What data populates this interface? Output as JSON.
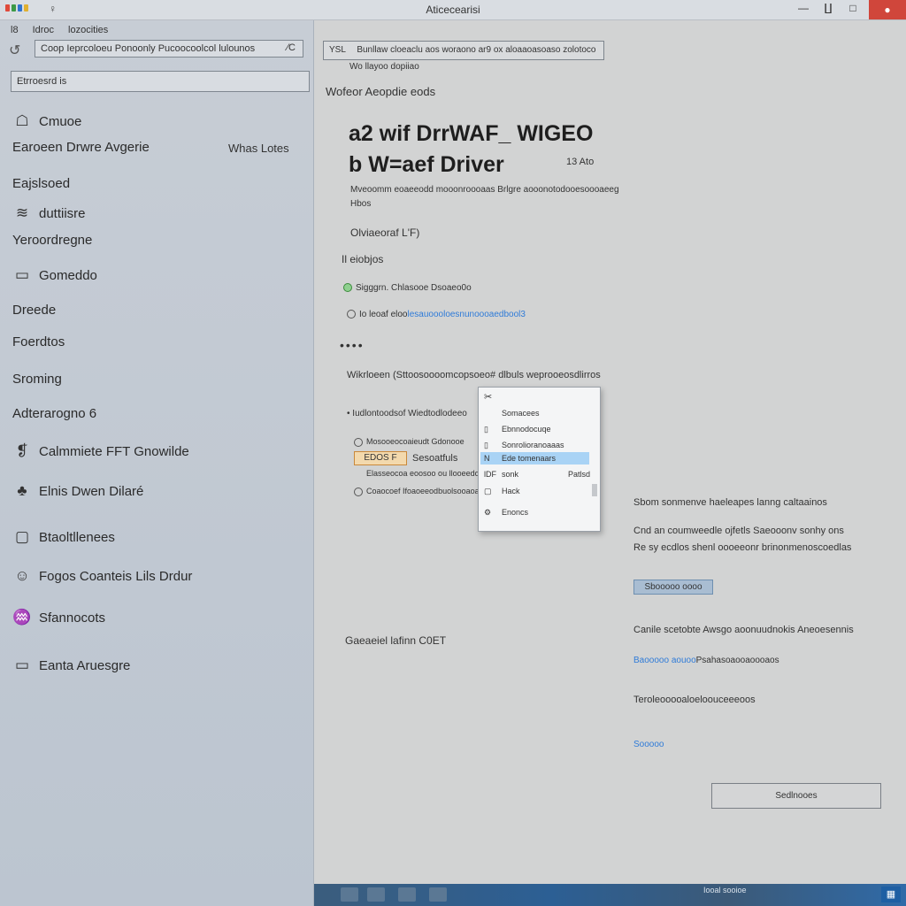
{
  "window": {
    "title": "Aticecearisi",
    "app_icon": "♀",
    "minimize": "—",
    "restore": "∐",
    "maximize": "□",
    "close": "●",
    "logo_colors": [
      "#e04a3a",
      "#3c9a46",
      "#2f74d0",
      "#e0b030"
    ]
  },
  "sidebar": {
    "menu": [
      "l8",
      "Idroc",
      "lozocities"
    ],
    "back_glyph": "↺",
    "search_value": "Coop Ieprcoloeu Ponoonly Pucoocoolcol lulounos",
    "search_icon": "∕C",
    "filter_value": "Etrroesrd is",
    "items": [
      {
        "icon": "☖",
        "label": "Cmuoe"
      },
      {
        "icon": "",
        "label": "Earoeen Drwre Avgerie",
        "right": "Whas Lotes"
      },
      {
        "icon": "",
        "label": "Eajslsoed"
      },
      {
        "icon": "≋",
        "label": "duttiisre"
      },
      {
        "icon": "",
        "label": "Yeroordregne"
      },
      {
        "icon": "▭",
        "label": "Gomeddo"
      },
      {
        "icon": "",
        "label": "Dreede"
      },
      {
        "icon": "",
        "label": "Foerdtos"
      },
      {
        "icon": "",
        "label": "Sroming"
      },
      {
        "icon": "",
        "label": "Adterarogno 6"
      },
      {
        "icon": "❡",
        "label": "Calmmiete  FFT Gnowilde"
      },
      {
        "icon": "♣",
        "label": "Elnis Dwen Dilaré"
      },
      {
        "icon": "▢",
        "label": "Btaoltllenees"
      },
      {
        "icon": "☺",
        "label": "Fogos Coanteis Lils Drdur"
      },
      {
        "icon": "♒",
        "label": "Sfannocots"
      },
      {
        "icon": "▭",
        "label": "Eanta Aruesgre"
      }
    ]
  },
  "main": {
    "address_prefix": "YSL",
    "address_value": "Bunllaw cloeaclu aos woraono ar9 ox aloaaoasoaso zolotoco",
    "address_sub": "Wo llayoo dopiiao",
    "section_label": "Wofeor Aeopdie eods",
    "heading1": "a2 wif DrrWAF_ WIGEO",
    "heading2": "b W=aef Driver",
    "heading2_tag": "13 Ato",
    "desc_line1": "Mveoomm eoaeeodd mooonroooaas Brlgre aooonotodooesoooaeeg",
    "desc_line2": "Hbos",
    "version": "Olviaeoraf L'F)",
    "subheading": "Il eiobjos",
    "status1": "Sigggrn. Chlasooe Dsoaeo0o",
    "status2_prefix": "Io leoaf eloo",
    "status2_link": "lesauoooloesnunoooaedbool3",
    "dots": "••••",
    "mid_text": "Wikrloeen (Sttoosoooomcopsoeo# dlbuls weprooeosdlirros",
    "option1": "Iudlontoodsof Wiedtodlodeeo",
    "option2": "Mosooeocoaieudt Gdonooe",
    "badge_label": "EDOS F",
    "option2b": "Sesoatfuls",
    "option3": "Elasseocoa eoosoo ou llooeedoa",
    "option4": "Coaocoef Ifoaoeeodbuolsooaoaoo",
    "caption": "Gaeaeiel lafinn C0ET",
    "popup": {
      "icon": "✂",
      "items": [
        {
          "icon": "",
          "label": "Somacees"
        },
        {
          "icon": "▯",
          "label": "Ebnnodocuqe"
        },
        {
          "icon": "▯",
          "label": "Sonrolioranoaaas"
        },
        {
          "icon": "N",
          "label": "Ede tomenaars",
          "selected": true
        },
        {
          "icon": "lDF",
          "label": "sonk",
          "right": "Patlsd"
        },
        {
          "icon": "▢",
          "label": "Hack"
        },
        {
          "icon": "⚙",
          "label": "Enoncs"
        }
      ]
    },
    "right_panel": {
      "title": "Sbom sonmenve haeleapes lanng caltaainos",
      "line1": "Cnd an coumweedle ojfetls Saeooonv sonhy ons",
      "line2": "Re sy ecdlos shenl oooeeonr brinonmenoscoedlas",
      "button_label": "Sbooooo oooo",
      "block2_title": "Canile scetobte Awsgo aoonuudnokis Aneoesennis",
      "block2_link": "Baooooo aouoo",
      "block2_rest": "Psahasoaooaoooaos",
      "block3": "Teroleooooaloeloouceeeoos",
      "block3_link": "Sooooo",
      "bottom_button": "Sedlnooes"
    }
  },
  "taskbar": {
    "text": "Iooal sooioe",
    "tray": "▦"
  }
}
